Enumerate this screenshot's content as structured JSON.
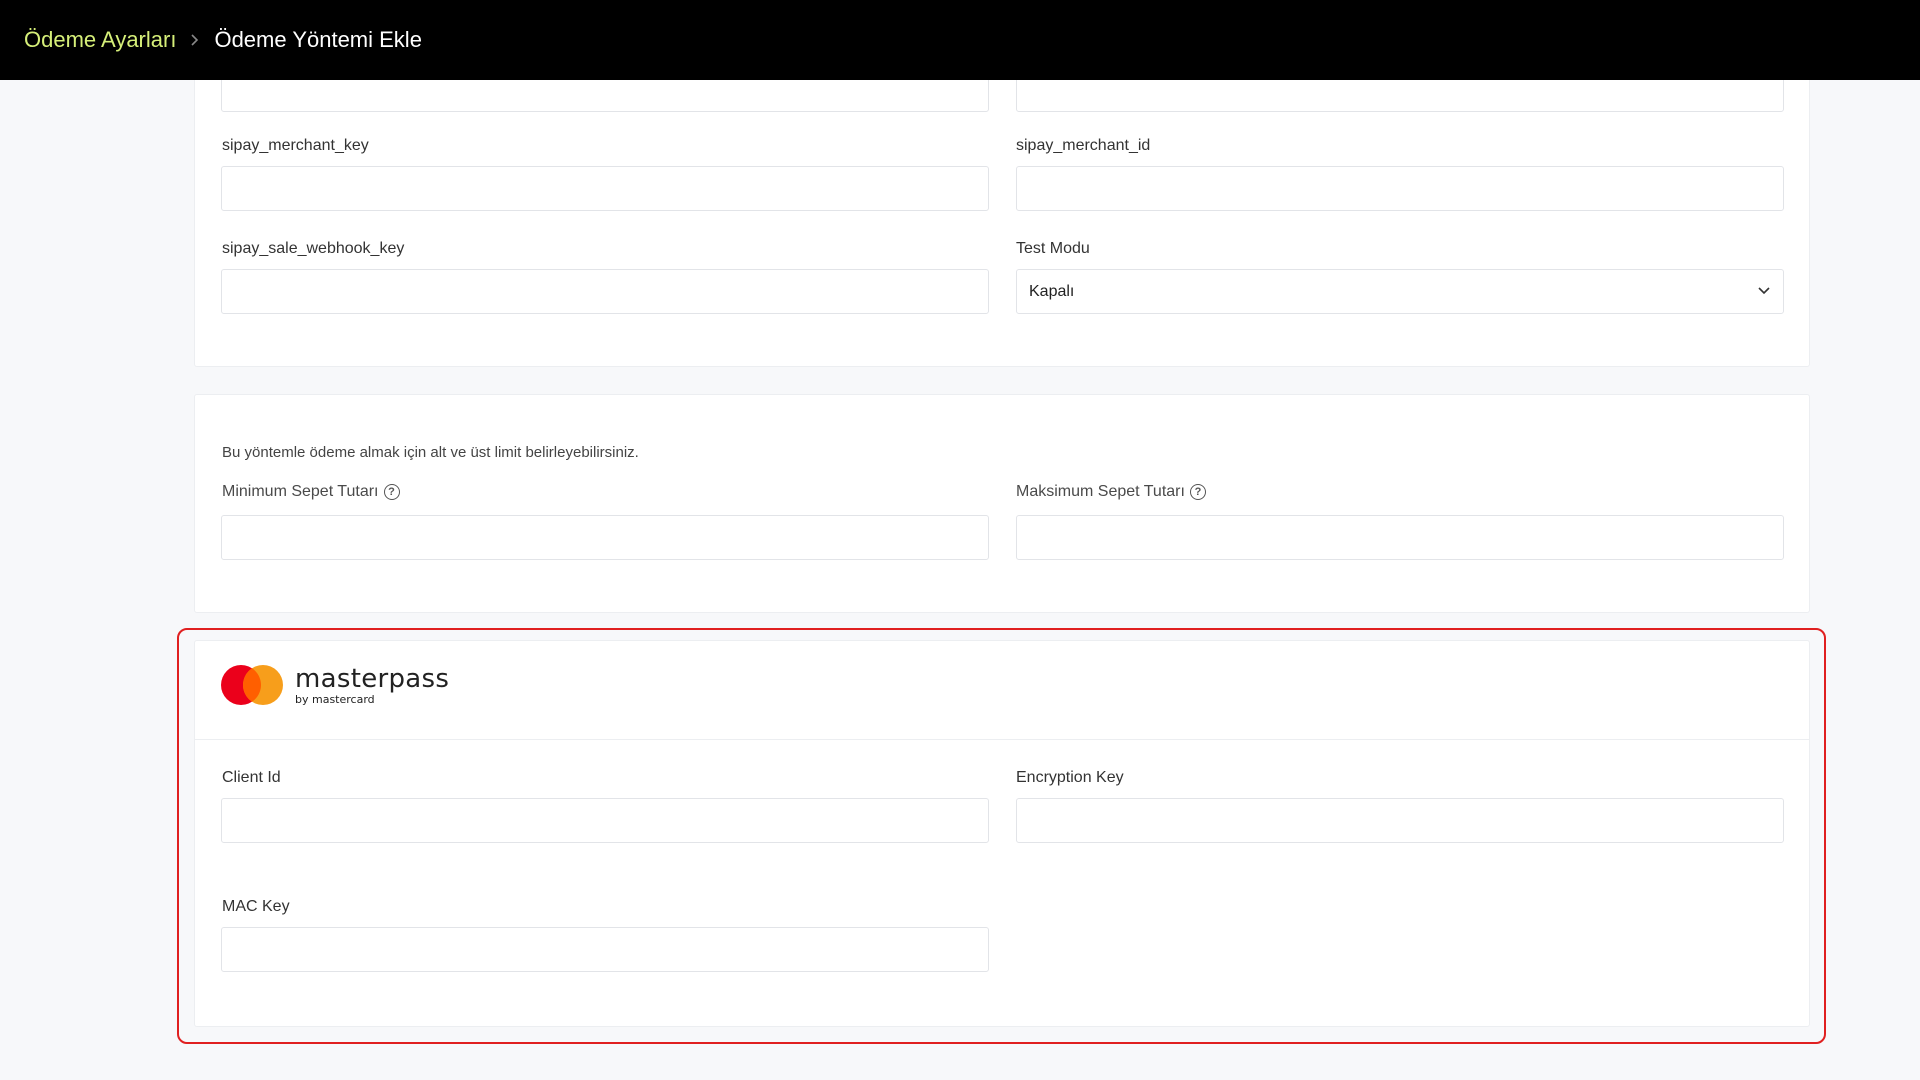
{
  "breadcrumb": {
    "parent": "Ödeme Ayarları",
    "current": "Ödeme Yöntemi Ekle"
  },
  "sipay": {
    "merchant_key_label": "sipay_merchant_key",
    "merchant_id_label": "sipay_merchant_id",
    "sale_webhook_key_label": "sipay_sale_webhook_key",
    "test_mode_label": "Test Modu",
    "test_mode_value": "Kapalı"
  },
  "limits": {
    "hint": "Bu yöntemle ödeme almak için alt ve üst limit belirleyebilirsiniz.",
    "min_label": "Minimum Sepet Tutarı",
    "max_label": "Maksimum Sepet Tutarı"
  },
  "masterpass": {
    "brand": "masterpass",
    "by": "by mastercard",
    "client_id_label": "Client Id",
    "encryption_key_label": "Encryption Key",
    "mac_key_label": "MAC Key"
  },
  "colors": {
    "accent": "#d6ef79",
    "highlight": "#e02020",
    "mastercard_red": "#eb001b",
    "mastercard_orange": "#f79e1b"
  }
}
